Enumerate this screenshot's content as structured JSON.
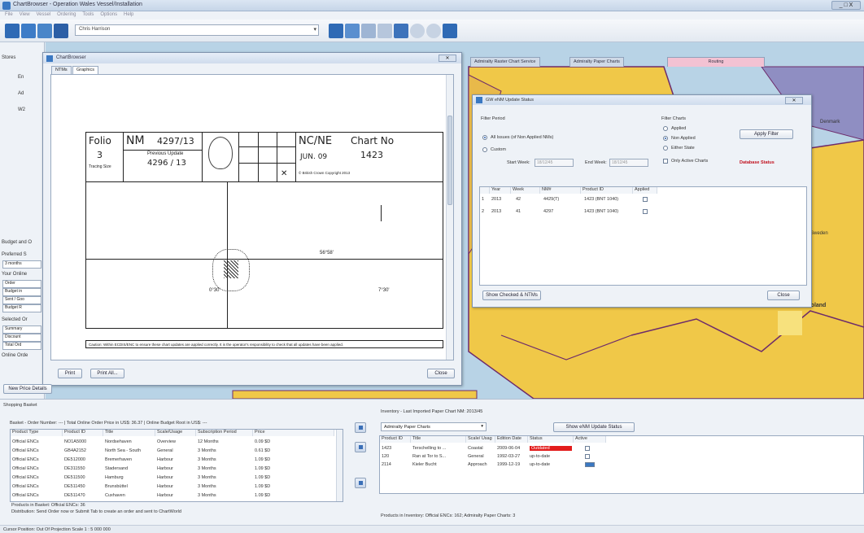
{
  "window": {
    "title": "ChartBrowser - Operation Wales Vessel/Installation",
    "controls": "_ □ X"
  },
  "menu": [
    "File",
    "View",
    "Vessel",
    "Ordering",
    "Tools",
    "Options",
    "Help"
  ],
  "toolbar": {
    "combo_value": "Chris Harrison"
  },
  "left_panel": {
    "section_top": "Stores",
    "items": [
      "En",
      "Ad",
      "W2"
    ],
    "budget_label": "Budget and O",
    "preferred": "Preferred S",
    "preferred_value": "3 months",
    "your_online": "Your Online",
    "budget_rows": [
      "Order",
      "Budget in",
      "Sent / Goo",
      "Budget R"
    ],
    "selected": "Selected Or",
    "summary_rows": [
      "Summary",
      "Discount",
      "Total Ord"
    ],
    "online_order": "Online Orde",
    "new_price_btn": "New Price Details",
    "shopping_basket": "Shopping Basket"
  },
  "map": {
    "tabs": [
      "Admiralty Raster Chart Service",
      "Admiralty Paper Charts",
      "Routing"
    ],
    "labels": [
      "Poland",
      "Denmark",
      "Sweden"
    ]
  },
  "chart_browser": {
    "title": "ChartBrowser",
    "tabs": [
      "NTMs",
      "Graphics"
    ],
    "folio_label": "Folio",
    "folio_number": "3",
    "folio_sub": "Tracing Size",
    "nm_label": "NM",
    "nm_value": "4297/13",
    "previous_update_label": "Previous Update",
    "previous_update_value": "4296 / 13",
    "region": "NC/NE",
    "date": "JUN. 09",
    "chart_no_label": "Chart No",
    "chart_no_value": "1423",
    "copyright": "© British Crown Copyright 2013",
    "coord_top": "56°58'",
    "coord_left": "0°30'",
    "coord_right": "7°30'",
    "caution": "Caution: Within ECDIS/ENC to ensure these chart updates are applied correctly. It is the operator's responsibility to check that all updates have been applied.",
    "print_btn": "Print",
    "print_all_btn": "Print All...",
    "close_btn": "Close"
  },
  "nm_dialog": {
    "title": "GW eNM Update Status",
    "filter_period_label": "Filter Period",
    "filter_all": "All Issues (of Non Applied NMs)",
    "filter_custom": "Custom",
    "start_week_label": "Start Week:",
    "start_week_value": "18/12/45",
    "end_week_label": "End Week:",
    "end_week_value": "18/12/45",
    "filter_charts_label": "Filter Charts",
    "filter_applied": "Applied",
    "filter_non_applied": "Non Applied",
    "filter_either": "Either State",
    "only_active": "Only Active Charts",
    "apply_btn": "Apply Filter",
    "database_status": "Database Status",
    "columns": [
      "Year",
      "Week",
      "NM#",
      "Product ID",
      "Applied"
    ],
    "rows": [
      {
        "num": "1",
        "year": "2013",
        "week": "42",
        "nm": "4429(T)",
        "product": "1423 (BNT 1040)",
        "applied": ""
      },
      {
        "num": "2",
        "year": "2013",
        "week": "41",
        "nm": "4297",
        "product": "1423 (BNT 1040)",
        "applied": ""
      }
    ],
    "show_checked_btn": "Show Checked & NTMs",
    "close_btn": "Close"
  },
  "basket": {
    "header": "Basket - Order Number: --- | Total Online Order Price in US$: 36.37 | Online Budget Root in US$: ---",
    "columns": [
      "Product Type",
      "Product ID",
      "Title",
      "Scale/Usage",
      "Subscription Period",
      "Price"
    ],
    "rows": [
      [
        "Official ENCs",
        "NO1A5000",
        "Nordsehaven",
        "Overview",
        "12 Months",
        "0.09 $D"
      ],
      [
        "Official ENCs",
        "GB4A2152",
        "North Sea - South",
        "General",
        "3 Months",
        "0.61 $D"
      ],
      [
        "Official ENCs",
        "DE512000",
        "Bremerhaven",
        "Harbour",
        "3 Months",
        "1.09 $D"
      ],
      [
        "Official ENCs",
        "DE311550",
        "Stadersand",
        "Harbour",
        "3 Months",
        "1.09 $D"
      ],
      [
        "Official ENCs",
        "DE511500",
        "Hamburg",
        "Harbour",
        "3 Months",
        "1.09 $D"
      ],
      [
        "Official ENCs",
        "DE511450",
        "Brunsbüttel",
        "Harbour",
        "3 Months",
        "1.09 $D"
      ],
      [
        "Official ENCs",
        "DE511470",
        "Cuxhaven",
        "Harbour",
        "3 Months",
        "1.09 $D"
      ]
    ],
    "footer1": "Products in Basket: Official ENCs: 36",
    "footer2": "Distribution: Send Order now or Submit Tab to create an order and sent to ChartWorld"
  },
  "inventory": {
    "header": "Inventory - Last Imported Paper Chart NM: 2013/45",
    "filter_value": "Admiralty Paper Charts",
    "show_btn": "Show eNM Update Status",
    "columns": [
      "Product ID",
      "Title",
      "Scale/ Usag",
      "Edition Date",
      "Status",
      "Active"
    ],
    "rows": [
      {
        "id": "1423",
        "title": "Terschelling to ...",
        "scale": "Coastal",
        "date": "2009-06-04",
        "status": "Outdated",
        "status_color": "#e21b1b"
      },
      {
        "id": "120",
        "title": "Ran at Tor to S...",
        "scale": "General",
        "date": "1992-03-27",
        "status": "up-to-date",
        "status_color": ""
      },
      {
        "id": "2114",
        "title": "Kieler Bucht",
        "scale": "Approach",
        "date": "1999-12-19",
        "status": "up-to-date",
        "status_color": ""
      }
    ],
    "footer": "Products in Inventory: Official ENCs: 162; Admiralty Paper Charts: 3"
  },
  "status_bar": "Cursor Position: Out Of Projection  Scale 1 : 5 000 000",
  "colors": {
    "accent": "#3a78c2",
    "map_land": "#f0c848",
    "map_sea": "#b8d3e6",
    "map_border": "#6d2b6b",
    "routing_tab": "#f3c2d3"
  }
}
